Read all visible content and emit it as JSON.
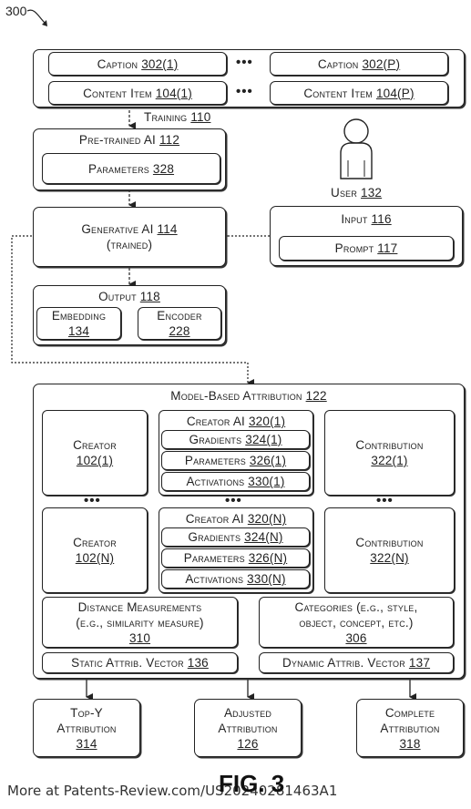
{
  "figure": {
    "ref_number": "300",
    "fig_label": "FIG. 3",
    "watermark": "More at Patents-Review.com/US20240281463A1"
  },
  "training_data": {
    "captions": [
      {
        "label": "Caption",
        "num": "302(1)"
      },
      {
        "label": "Caption",
        "num": "302(P)"
      }
    ],
    "content_items": [
      {
        "label": "Content Item",
        "num": "104(1)"
      },
      {
        "label": "Content Item",
        "num": "104(P)"
      }
    ],
    "ellipsis": "•••"
  },
  "training": {
    "label": "Training",
    "num": "110"
  },
  "pretrained_ai": {
    "label": "Pre-trained AI",
    "num": "112",
    "parameters": {
      "label": "Parameters",
      "num": "328"
    }
  },
  "generative_ai": {
    "label": "Generative AI",
    "num": "114",
    "sub": "(trained)"
  },
  "user": {
    "label": "User",
    "num": "132"
  },
  "input": {
    "label": "Input",
    "num": "116",
    "prompt": {
      "label": "Prompt",
      "num": "117"
    }
  },
  "output": {
    "label": "Output",
    "num": "118",
    "embedding": {
      "label": "Embedding",
      "num": "134"
    },
    "encoder": {
      "label": "Encoder",
      "num": "228"
    }
  },
  "attribution": {
    "label": "Model-Based Attribution",
    "num": "122",
    "rows": [
      {
        "creator": {
          "label": "Creator",
          "num": "102(1)"
        },
        "creator_ai": {
          "label": "Creator AI",
          "num": "320(1)"
        },
        "gradients": {
          "label": "Gradients",
          "num": "324(1)"
        },
        "parameters": {
          "label": "Parameters",
          "num": "326(1)"
        },
        "activations": {
          "label": "Activations",
          "num": "330(1)"
        },
        "contribution": {
          "label": "Contribution",
          "num": "322(1)"
        }
      },
      {
        "creator": {
          "label": "Creator",
          "num": "102(N)"
        },
        "creator_ai": {
          "label": "Creator AI",
          "num": "320(N)"
        },
        "gradients": {
          "label": "Gradients",
          "num": "324(N)"
        },
        "parameters": {
          "label": "Parameters",
          "num": "326(N)"
        },
        "activations": {
          "label": "Activations",
          "num": "330(N)"
        },
        "contribution": {
          "label": "Contribution",
          "num": "322(N)"
        }
      }
    ],
    "ellipsis": "•••",
    "distance": {
      "line1": "Distance Measurements",
      "line2": "(e.g., similarity measure)",
      "num": "310"
    },
    "categories": {
      "line1": "Categories (e.g., style,",
      "line2": "object, concept, etc.)",
      "num": "306"
    },
    "static_vector": {
      "label": "Static Attrib. Vector",
      "num": "136"
    },
    "dynamic_vector": {
      "label": "Dynamic Attrib. Vector",
      "num": "137"
    }
  },
  "results": [
    {
      "line1": "Top-Y",
      "line2": "Attribution",
      "num": "314"
    },
    {
      "line1": "Adjusted",
      "line2": "Attribution",
      "num": "126"
    },
    {
      "line1": "Complete",
      "line2": "Attribution",
      "num": "318"
    }
  ]
}
